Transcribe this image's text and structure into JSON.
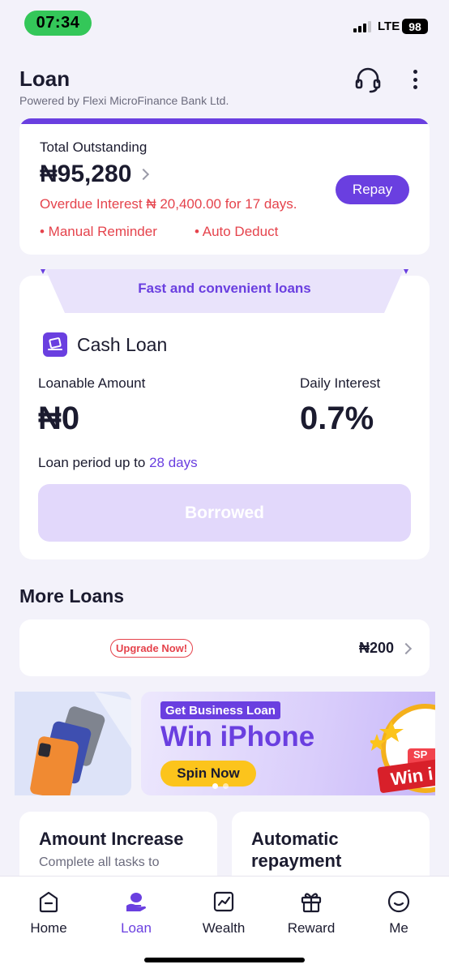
{
  "status_bar": {
    "time": "07:34",
    "network": "LTE",
    "battery": "98"
  },
  "header": {
    "title": "Loan",
    "subtitle": "Powered by Flexi MicroFinance Bank Ltd.",
    "support_icon": "headset-icon",
    "more_icon": "more-vertical-icon"
  },
  "outstanding": {
    "label": "Total Outstanding",
    "amount": "₦95,280",
    "overdue_text": "Overdue Interest ₦ 20,400.00 for 17 days.",
    "reminder_manual": "• Manual Reminder",
    "reminder_auto": "• Auto Deduct",
    "repay_label": "Repay"
  },
  "cash_loan": {
    "banner": "Fast and convenient loans",
    "title": "Cash Loan",
    "loanable_label": "Loanable Amount",
    "loanable_value": "₦0",
    "interest_label": "Daily Interest",
    "interest_value": "0.7%",
    "period_prefix": "Loan period up to",
    "period_value": "28 days",
    "button_label": "Borrowed"
  },
  "more_loans": {
    "title": "More Loans",
    "badge": "Upgrade Now!",
    "amount": "₦200"
  },
  "promo": {
    "tag": "Get Business Loan",
    "title": "Win iPhone",
    "button": "Spin Now",
    "wheel_text": "Win i",
    "wheel_tag": "SP"
  },
  "tiles": [
    {
      "title": "Amount Increase",
      "desc": "Complete all tasks to"
    },
    {
      "title": "Automatic repayment",
      "desc": ""
    }
  ],
  "nav": [
    {
      "label": "Home",
      "icon": "home-icon",
      "active": false
    },
    {
      "label": "Loan",
      "icon": "loan-icon",
      "active": true
    },
    {
      "label": "Wealth",
      "icon": "wealth-icon",
      "active": false
    },
    {
      "label": "Reward",
      "icon": "gift-icon",
      "active": false
    },
    {
      "label": "Me",
      "icon": "smile-icon",
      "active": false
    }
  ],
  "colors": {
    "accent": "#6a3fe0",
    "danger": "#e5434c",
    "status_green": "#34c759",
    "yellow": "#fcc41c"
  }
}
